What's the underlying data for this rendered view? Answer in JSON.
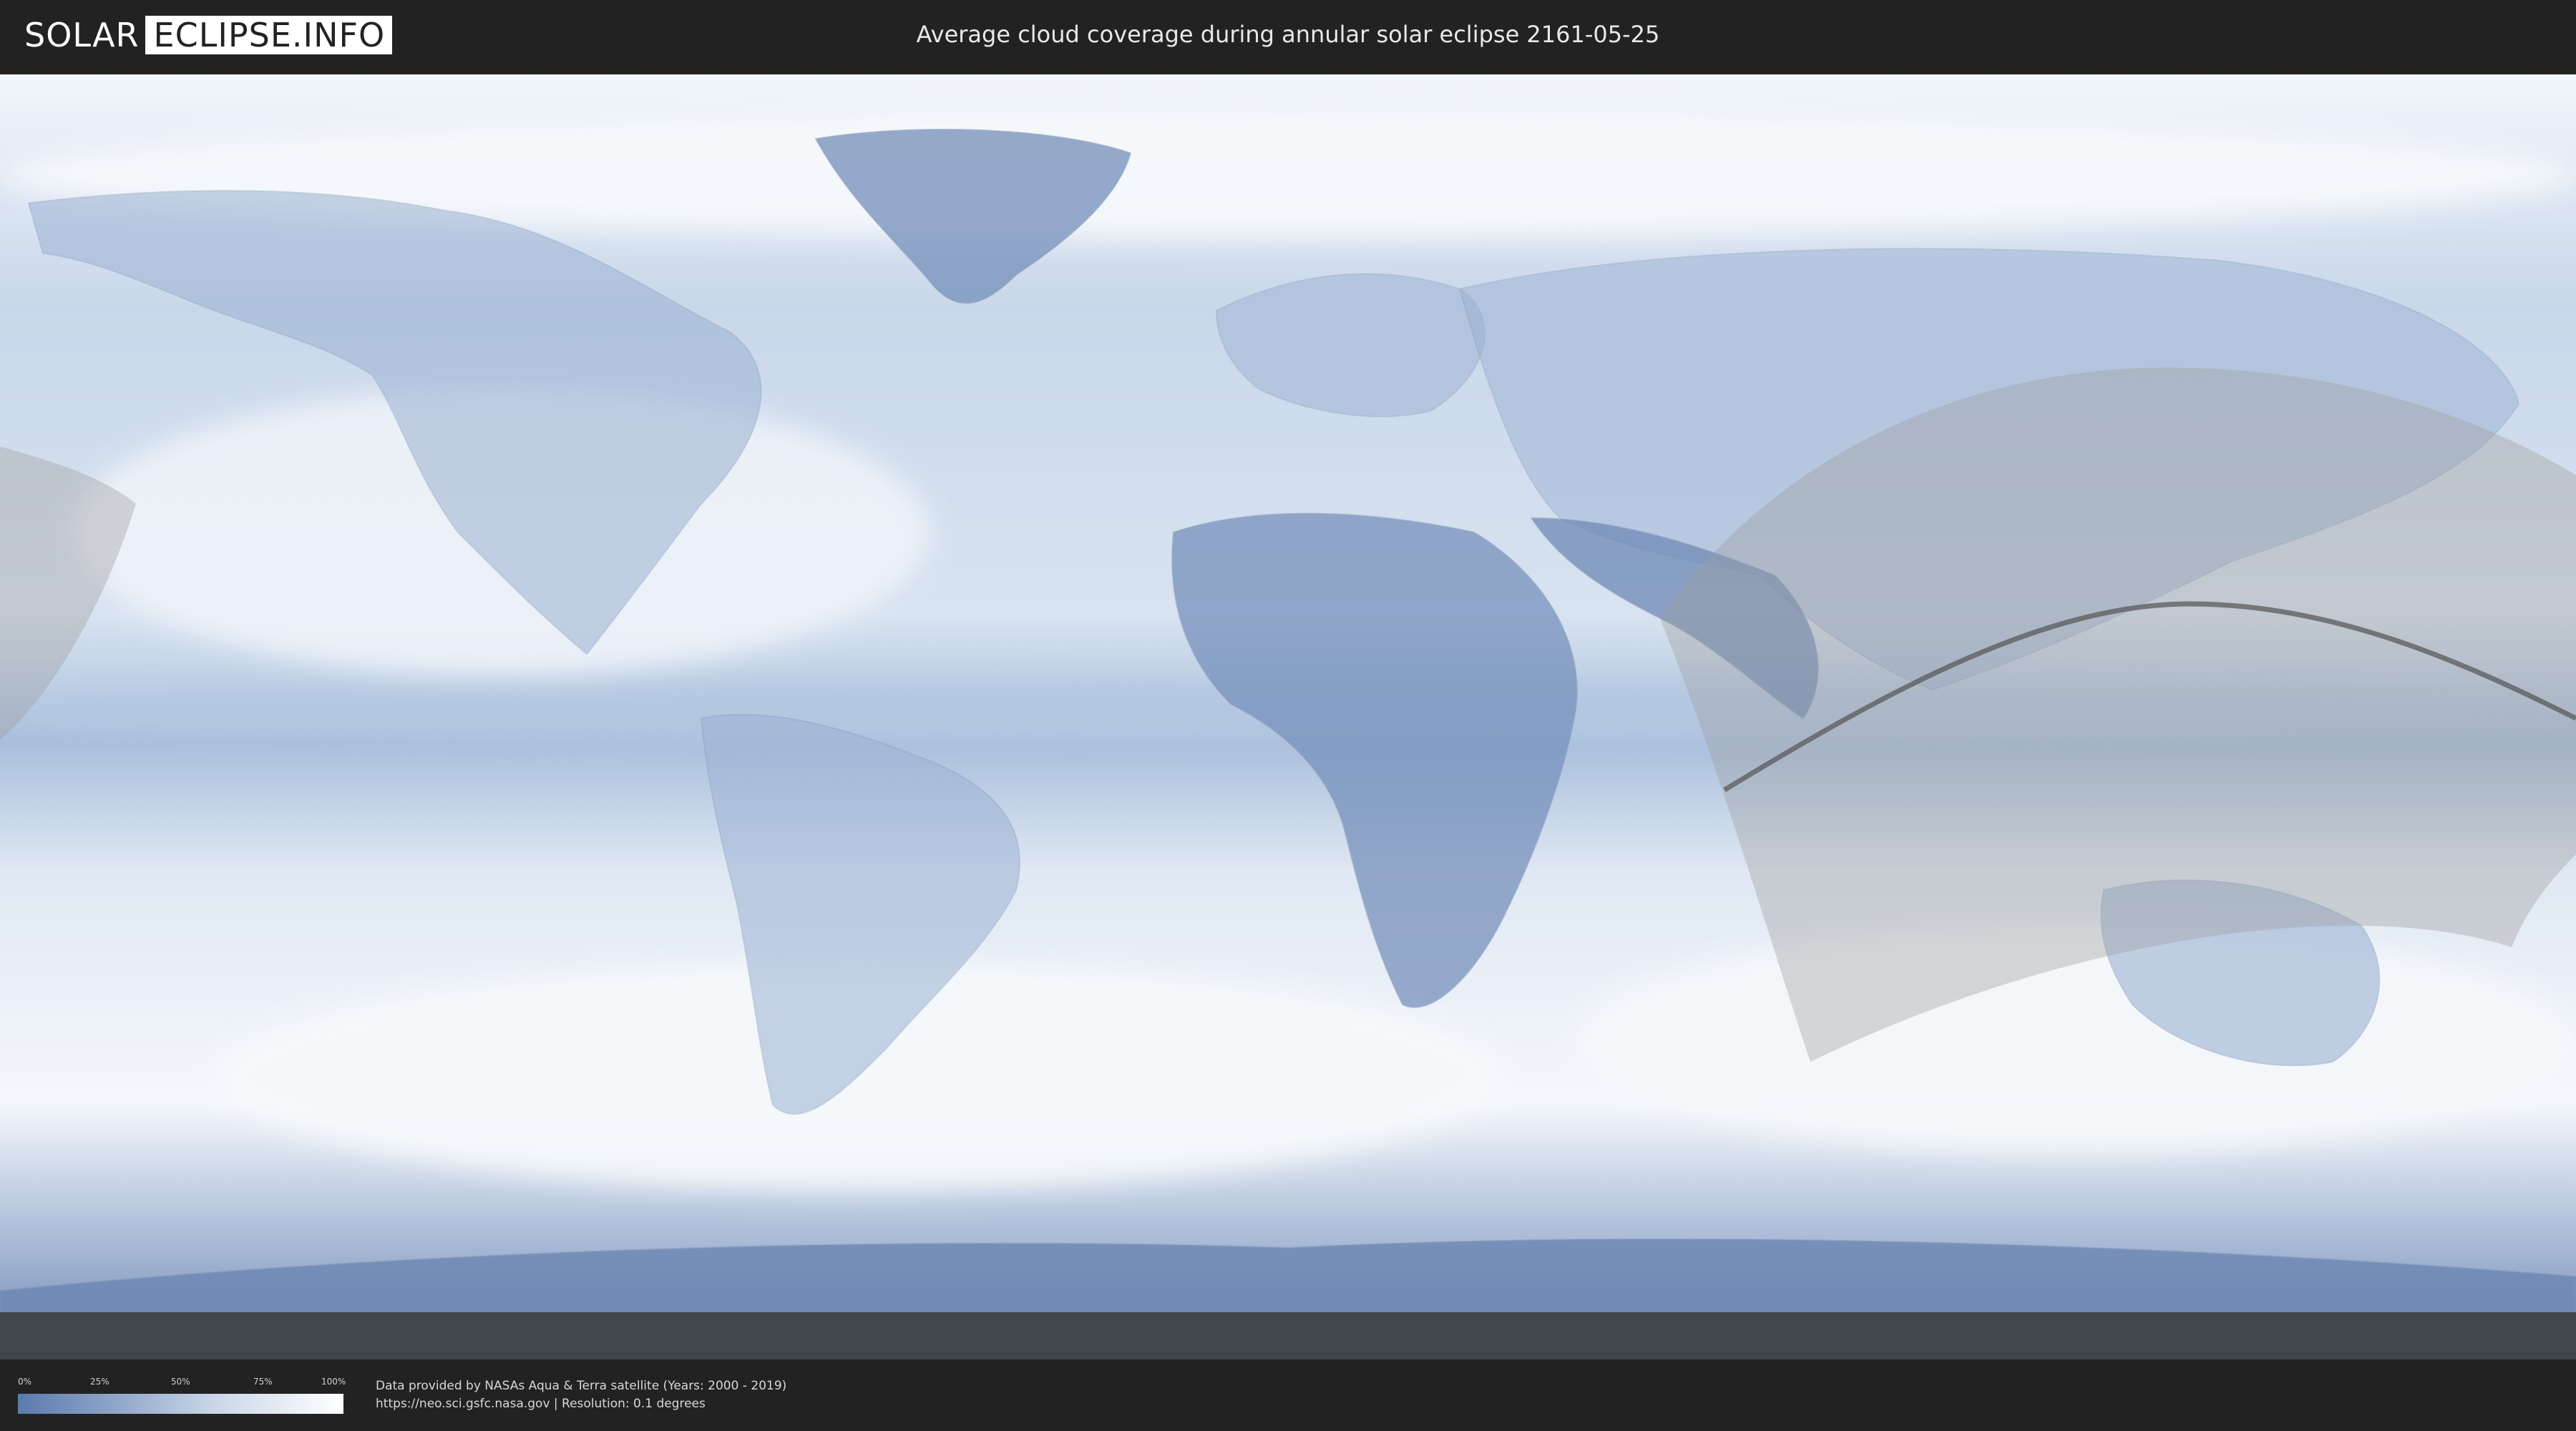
{
  "header": {
    "logo_left": "SOLAR",
    "logo_right": "ECLIPSE.INFO",
    "title": "Average cloud coverage during annular solar eclipse 2161-05-25"
  },
  "map": {
    "kind": "equirectangular world cloud cover map",
    "colors": {
      "clear_sky": "#5b7aad",
      "full_cloud": "#ffffff",
      "eclipse_zone": "#a8a8a8",
      "central_line": "#555555"
    }
  },
  "legend": {
    "ticks": [
      "0%",
      "25%",
      "50%",
      "75%",
      "100%"
    ]
  },
  "footer": {
    "credit_line1": "Data provided by NASAs Aqua & Terra satellite (Years: 2000 - 2019)",
    "credit_line2": "https://neo.sci.gsfc.nasa.gov | Resolution: 0.1 degrees"
  }
}
